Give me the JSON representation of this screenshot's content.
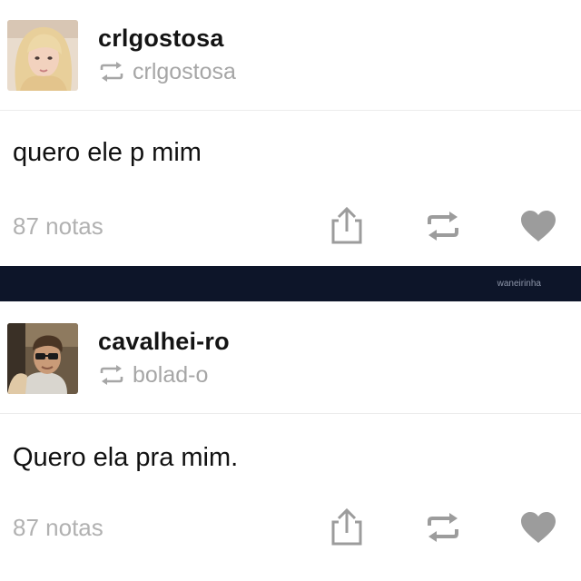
{
  "posts": [
    {
      "username": "crlgostosa",
      "reblog_source": "crlgostosa",
      "text": "quero ele p mim",
      "notes": "87 notas",
      "avatar_icon": "female-avatar-photo"
    },
    {
      "username": "cavalhei-ro",
      "reblog_source": "bolad-o",
      "text": "Quero ela pra mim.",
      "notes": "87 notas",
      "avatar_icon": "male-avatar-photo"
    }
  ],
  "divider": {
    "watermark": "waneirinha"
  },
  "icons": [
    "reblog-icon",
    "share-icon",
    "heart-icon"
  ],
  "colors": {
    "text": "#121212",
    "muted": "#a6a6a6",
    "icon": "#9c9c9c",
    "divider": "#0d1529",
    "page": "#ffffff"
  }
}
